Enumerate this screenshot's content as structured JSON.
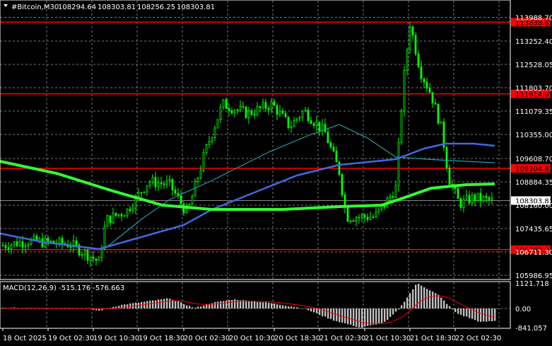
{
  "header": {
    "symbol": "#Bitcoin,M30",
    "open": "108294.64",
    "high": "108303.81",
    "low": "108256.25",
    "close": "108303.81"
  },
  "macd_label": "MACD(12,26,9) -515.176 -576.663",
  "price_axis": [
    "113988.70",
    "113252.40",
    "112528.05",
    "111803.70",
    "111079.35",
    "110355.00",
    "109608.70",
    "108884.35",
    "108160.00",
    "107435.65",
    "106711.30",
    "105986.95"
  ],
  "levels": [
    {
      "label": "113838.62",
      "price": 113838.62
    },
    {
      "label": "111614.09",
      "price": 111614.09
    },
    {
      "label": "109304.82",
      "price": 109304.82
    },
    {
      "label": "106782.97",
      "price": 106782.97
    }
  ],
  "current_price": {
    "label": "108303.81",
    "price": 108303.81
  },
  "macd_axis": [
    "1121.718",
    "0.00",
    "-841.057"
  ],
  "time_axis": [
    "18 Oct 2025",
    "19 Oct 02:30",
    "19 Oct 10:30",
    "19 Oct 18:30",
    "20 Oct 02:30",
    "20 Oct 10:30",
    "20 Oct 18:30",
    "21 Oct 02:30",
    "21 Oct 10:30",
    "21 Oct 18:30",
    "22 Oct 02:30"
  ],
  "colors": {
    "bull": "#00ff00",
    "level": "#ff0000",
    "ma_slow": "#32ff32",
    "ma_mid": "#4169e1",
    "ma_fast": "#20a0a0",
    "macd_hist": "#c0c0c0",
    "macd_signal": "#ff0000"
  },
  "chart_data": {
    "type": "candlestick",
    "price_path": [
      [
        0,
        106900
      ],
      [
        40,
        107050
      ],
      [
        100,
        106950
      ],
      [
        140,
        106400
      ],
      [
        150,
        107700
      ],
      [
        180,
        108000
      ],
      [
        210,
        108900
      ],
      [
        240,
        108800
      ],
      [
        265,
        107900
      ],
      [
        290,
        109800
      ],
      [
        315,
        111300
      ],
      [
        350,
        111000
      ],
      [
        385,
        111300
      ],
      [
        410,
        110600
      ],
      [
        430,
        111100
      ],
      [
        460,
        110400
      ],
      [
        480,
        109200
      ],
      [
        490,
        107800
      ],
      [
        530,
        107800
      ],
      [
        545,
        108200
      ],
      [
        560,
        108700
      ],
      [
        570,
        111800
      ],
      [
        580,
        113800
      ],
      [
        595,
        112300
      ],
      [
        610,
        111600
      ],
      [
        625,
        110500
      ],
      [
        635,
        109000
      ],
      [
        650,
        108200
      ],
      [
        670,
        108400
      ],
      [
        695,
        108300
      ]
    ],
    "macd_hist_path": [
      [
        0,
        30
      ],
      [
        120,
        20
      ],
      [
        140,
        -100
      ],
      [
        170,
        150
      ],
      [
        240,
        450
      ],
      [
        275,
        20
      ],
      [
        300,
        250
      ],
      [
        330,
        400
      ],
      [
        380,
        250
      ],
      [
        430,
        0
      ],
      [
        470,
        -500
      ],
      [
        510,
        -850
      ],
      [
        545,
        -600
      ],
      [
        565,
        0
      ],
      [
        590,
        1121
      ],
      [
        620,
        600
      ],
      [
        645,
        -200
      ],
      [
        680,
        -600
      ],
      [
        700,
        -550
      ]
    ]
  }
}
